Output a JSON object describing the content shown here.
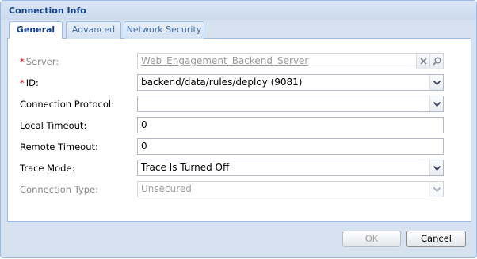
{
  "dialog": {
    "title": "Connection Info"
  },
  "tabs": [
    {
      "label": "General",
      "active": true
    },
    {
      "label": "Advanced",
      "active": false
    },
    {
      "label": "Network Security",
      "active": false
    }
  ],
  "form": {
    "server": {
      "required_mark": "*",
      "label": "Server:",
      "value": "Web_Engagement_Backend_Server",
      "disabled": true,
      "icons": [
        "clear-icon",
        "search-icon"
      ]
    },
    "id": {
      "required_mark": "*",
      "label": "ID:",
      "value": "backend/data/rules/deploy (9081)",
      "icon": "chevron-down-icon"
    },
    "connection_protocol": {
      "label": "Connection Protocol:",
      "value": "",
      "icon": "chevron-down-icon"
    },
    "local_timeout": {
      "label": "Local Timeout:",
      "value": "0"
    },
    "remote_timeout": {
      "label": "Remote Timeout:",
      "value": "0"
    },
    "trace_mode": {
      "label": "Trace Mode:",
      "value": "Trace Is Turned Off",
      "icon": "chevron-down-icon"
    },
    "connection_type": {
      "label": "Connection Type:",
      "value": "Unsecured",
      "disabled": true,
      "icon": "chevron-down-icon"
    }
  },
  "buttons": {
    "ok_label": "OK",
    "cancel_label": "Cancel"
  },
  "colors": {
    "title_text": "#15428b",
    "border": "#99bbe8",
    "required": "#d40000",
    "window_bg": "#d6e2f0"
  }
}
